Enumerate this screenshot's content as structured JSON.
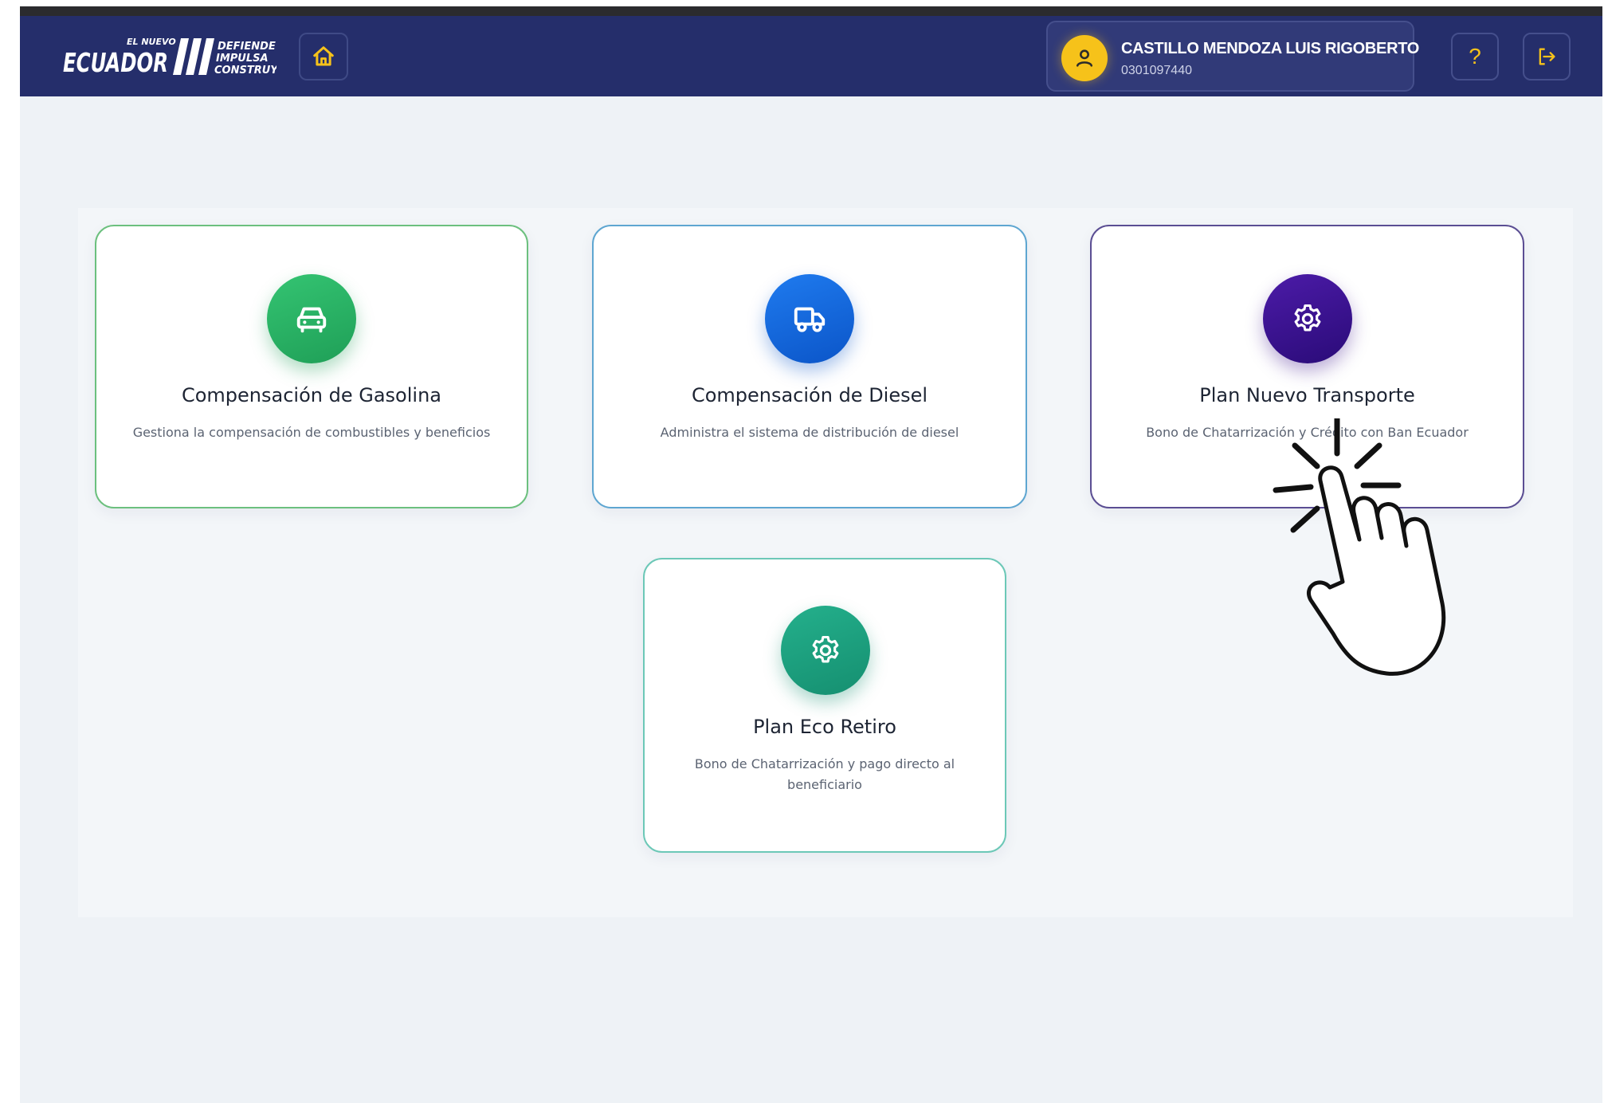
{
  "header": {
    "logo": {
      "small_top": "EL NUEVO",
      "main": "ECUADOR",
      "lines": [
        "DEFIENDE",
        "IMPULSA",
        "CONSTRUYE"
      ]
    },
    "home_icon": "home-icon",
    "user": {
      "name": "CASTILLO MENDOZA LUIS RIGOBERTO",
      "id": "0301097440",
      "icon": "user-icon"
    },
    "help_label": "?",
    "logout_icon": "logout-icon"
  },
  "cards": [
    {
      "title": "Compensación de Gasolina",
      "description": "Gestiona la compensación de combustibles y beneficios",
      "icon": "car-icon",
      "color": "#1f9f57"
    },
    {
      "title": "Compensación de Diesel",
      "description": "Administra el sistema de distribución de diesel",
      "icon": "truck-icon",
      "color": "#0b55c8"
    },
    {
      "title": "Plan Nuevo Transporte",
      "description": "Bono de Chatarrización y Crédito con Ban Ecuador",
      "icon": "gear-icon",
      "color": "#2a0b78"
    },
    {
      "title": "Plan Eco Retiro",
      "description_lines": [
        "Bono de Chatarrización y pago directo al",
        "beneficiario"
      ],
      "icon": "gear-icon",
      "color": "#158f70"
    }
  ],
  "colors": {
    "header_bg": "#252e6b",
    "accent_yellow": "#f6c21a",
    "page_bg": "#eef2f6"
  },
  "overlay": {
    "pointer_icon": "pointing-hand-click-icon"
  }
}
